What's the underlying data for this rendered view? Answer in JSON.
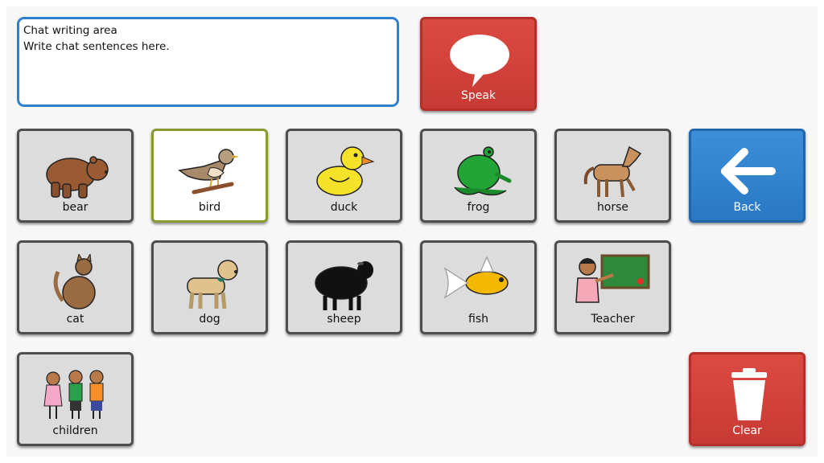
{
  "chat": {
    "title": "Chat writing area",
    "text": "Write chat sentences here."
  },
  "actions": {
    "speak": "Speak",
    "back": "Back",
    "clear": "Clear"
  },
  "symbols": {
    "bear": "bear",
    "bird": "bird",
    "duck": "duck",
    "frog": "frog",
    "horse": "horse",
    "cat": "cat",
    "dog": "dog",
    "sheep": "sheep",
    "fish": "fish",
    "teacher": "Teacher",
    "children": "children"
  },
  "selected_symbol": "bird",
  "colors": {
    "action_red": "#d0413b",
    "action_blue": "#2f80cf",
    "selected_border": "#8a9a33",
    "chat_border": "#2f7fcc"
  }
}
